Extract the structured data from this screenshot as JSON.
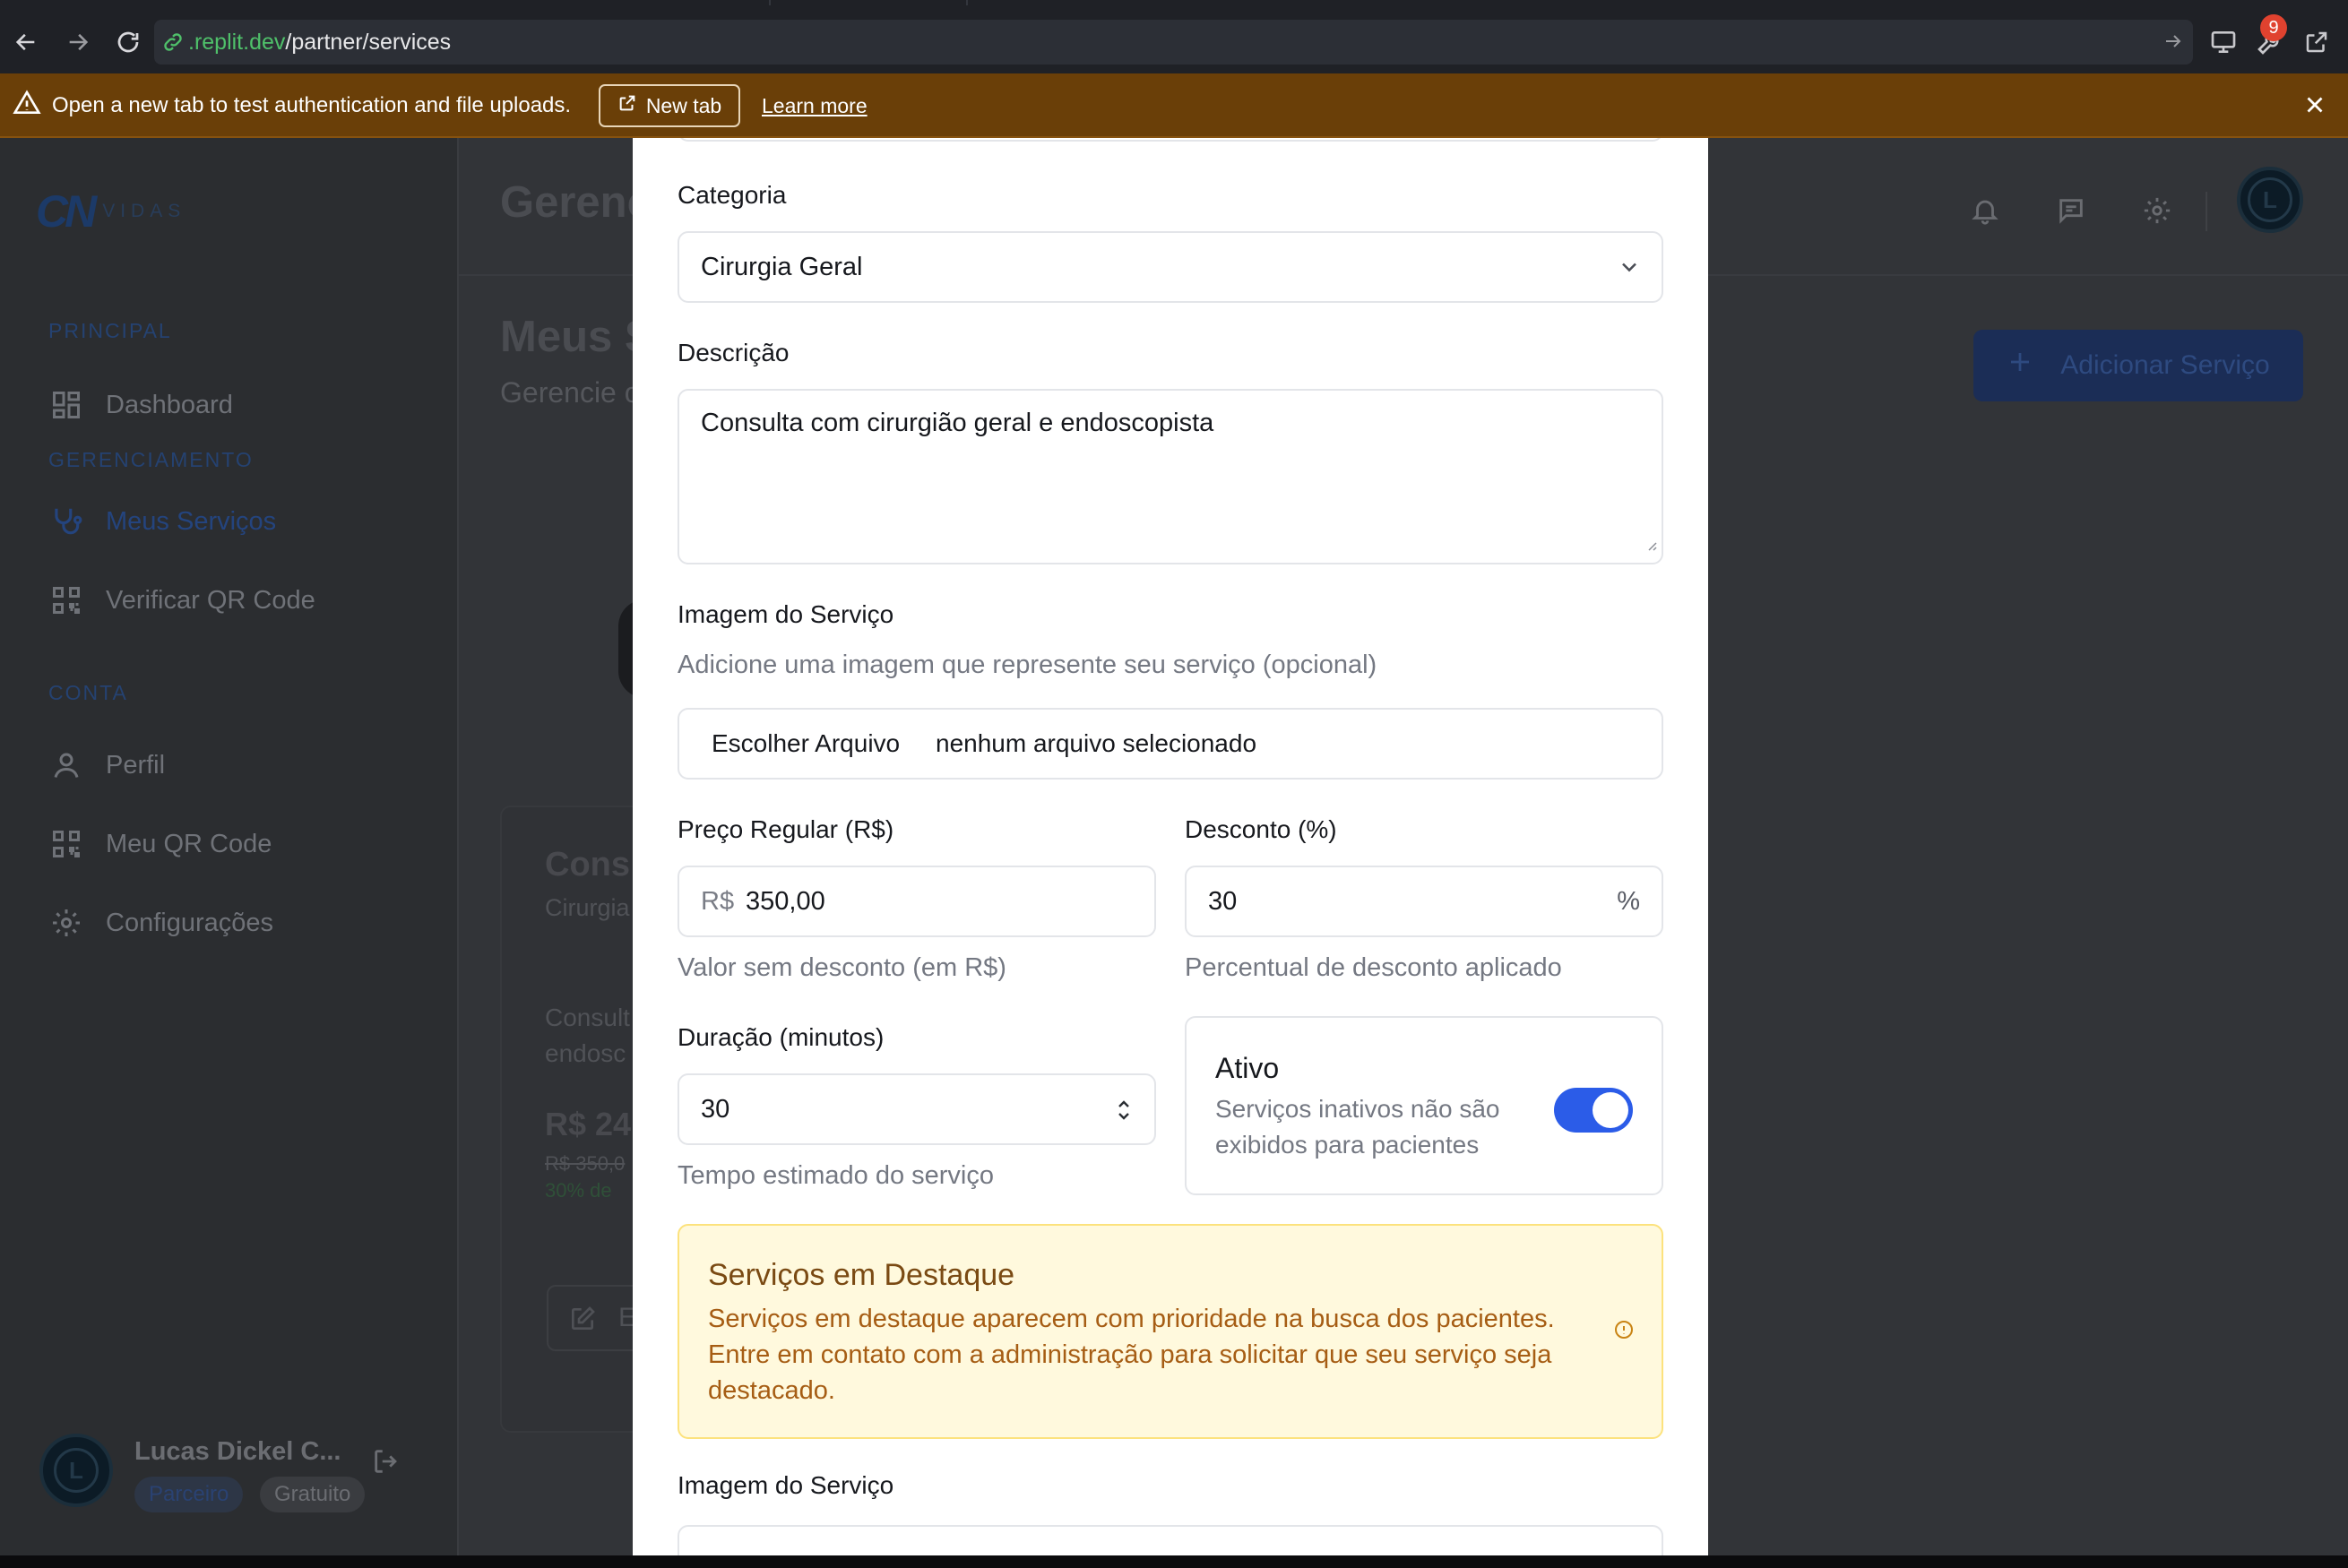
{
  "browser": {
    "url_host": ".replit.dev",
    "url_path": "/partner/services",
    "badge_count": "9"
  },
  "banner": {
    "message": "Open a new tab to test authentication and file uploads.",
    "new_tab_label": "New tab",
    "learn_more_label": "Learn more"
  },
  "sidebar": {
    "logo_mark": "CN",
    "logo_word": "VIDAS",
    "sections": {
      "principal": "PRINCIPAL",
      "gerenciamento": "GERENCIAMENTO",
      "conta": "CONTA"
    },
    "items": {
      "dashboard": "Dashboard",
      "meus_servicos": "Meus Serviços",
      "verificar_qr": "Verificar QR Code",
      "perfil": "Perfil",
      "meu_qr": "Meu QR Code",
      "configuracoes": "Configurações"
    },
    "user": {
      "name": "Lucas Dickel C...",
      "role": "Parceiro",
      "plan": "Gratuito"
    }
  },
  "background": {
    "topbar_title": "Gerenc",
    "page_title": "Meus S",
    "page_subtitle": "Gerencie o",
    "add_button": "Adicionar Serviço",
    "card_title": "Cons",
    "card_category": "Cirurgia",
    "card_desc_1": "Consult",
    "card_desc_2": "endosc",
    "card_price": "R$ 24",
    "card_old_price": "R$ 350,0",
    "card_discount": "30% de",
    "card_edit": "E"
  },
  "form": {
    "categoria_label": "Categoria",
    "categoria_value": "Cirurgia Geral",
    "descricao_label": "Descrição",
    "descricao_value": "Consulta com cirurgião geral e endoscopista",
    "imagem_label": "Imagem do Serviço",
    "imagem_hint": "Adicione uma imagem que represente seu serviço (opcional)",
    "file_button": "Escolher Arquivo",
    "file_status": "nenhum arquivo selecionado",
    "preco_label": "Preço Regular (R$)",
    "preco_prefix": "R$",
    "preco_value": "350,00",
    "preco_hint": "Valor sem desconto (em R$)",
    "desconto_label": "Desconto (%)",
    "desconto_value": "30",
    "desconto_suffix": "%",
    "desconto_hint": "Percentual de desconto aplicado",
    "duracao_label": "Duração (minutos)",
    "duracao_value": "30",
    "duracao_hint": "Tempo estimado do serviço",
    "ativo_label": "Ativo",
    "ativo_desc_1": "Serviços inativos não são",
    "ativo_desc_2": "exibidos para pacientes",
    "ativo_on": true,
    "destaque_title": "Serviços em Destaque",
    "destaque_desc": "Serviços em destaque aparecem com prioridade na busca dos pacientes. Entre em contato com a administração para solicitar que seu serviço seja destacado.",
    "imagem_label_2": "Imagem do Serviço"
  },
  "colors": {
    "accent": "#2b5ce8",
    "banner": "#6a3f08",
    "featured_bg": "#fff9dd",
    "featured_text": "#a65d14"
  }
}
